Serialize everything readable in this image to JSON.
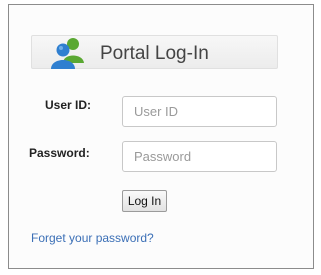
{
  "login": {
    "title": "Portal Log-In",
    "logo_icon": "users-icon",
    "userid_label": "User ID:",
    "userid_placeholder": "User ID",
    "userid_value": "",
    "password_label": "Password:",
    "password_placeholder": "Password",
    "password_value": "",
    "submit_label": "Log In",
    "forgot_link": "Forget your password?"
  },
  "colors": {
    "link": "#3b6fb6",
    "logo_green": "#5aa832",
    "logo_blue": "#2f7fd0"
  }
}
